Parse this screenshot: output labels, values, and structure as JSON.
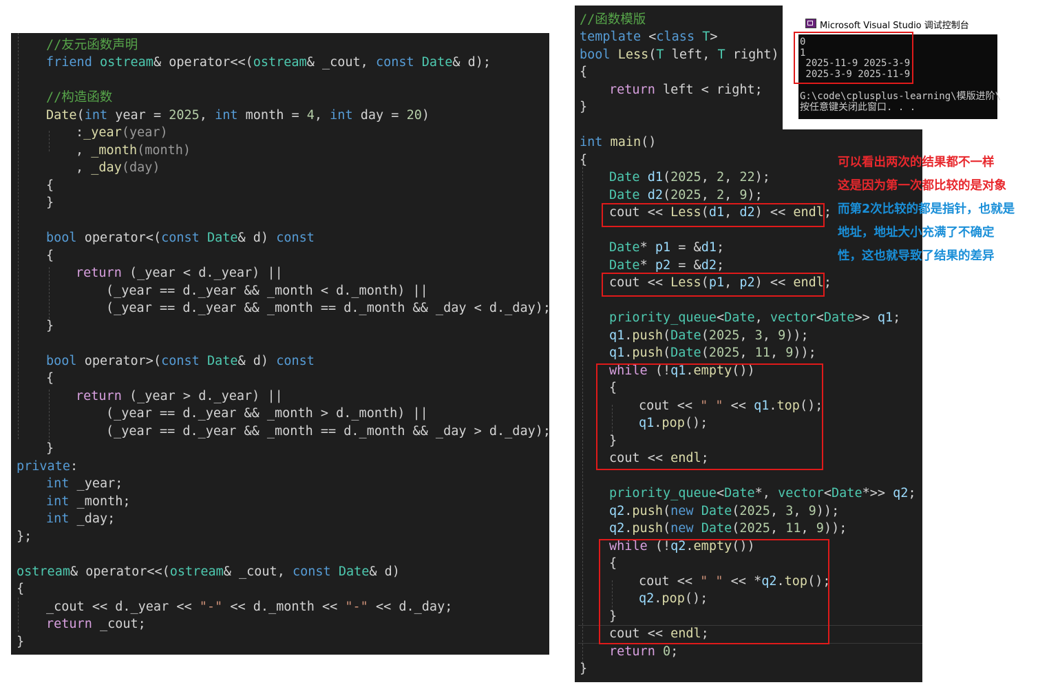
{
  "left_code": {
    "l01": "//友元函数声明",
    "l02_friend": "friend",
    "l02_ostream": "ostream",
    "l02_rest": "& operator<<(",
    "l02_ostream2": "ostream",
    "l02_rest2": "& _cout, ",
    "l02_const": "const",
    "l02_date": "Date",
    "l02_end": "& d);",
    "l03": "//构造函数",
    "l04_date": "Date",
    "l04_a": "(",
    "l04_int1": "int",
    "l04_b": " year = ",
    "l04_n1": "2025",
    "l04_c": ", ",
    "l04_int2": "int",
    "l04_d": " month = ",
    "l04_n2": "4",
    "l04_e": ", ",
    "l04_int3": "int",
    "l04_f": " day = ",
    "l04_n3": "20",
    "l04_g": ")",
    "l05_a": ":",
    "l05_b": "_year",
    "l05_c": "(year)",
    "l06_a": ", ",
    "l06_b": "_month",
    "l06_c": "(month)",
    "l07_a": ", ",
    "l07_b": "_day",
    "l07_c": "(day)",
    "l08": "{",
    "l09": "}",
    "l10_bool": "bool",
    "l10_a": " operator<(",
    "l10_const": "const",
    "l10_date": "Date",
    "l10_b": "& d) ",
    "l10_const2": "const",
    "l11": "{",
    "l12_ret": "return",
    "l12_rest": " (_year < d._year) ||",
    "l13": "(_year == d._year && _month < d._month) ||",
    "l14": "(_year == d._year && _month == d._month && _day < d._day);",
    "l15": "}",
    "l16_bool": "bool",
    "l16_a": " operator>(",
    "l16_const": "const",
    "l16_date": "Date",
    "l16_b": "& d) ",
    "l16_const2": "const",
    "l17": "{",
    "l18_ret": "return",
    "l18_rest": " (_year > d._year) ||",
    "l19": "(_year == d._year && _month > d._month) ||",
    "l20": "(_year == d._year && _month == d._month && _day > d._day);",
    "l21": "}",
    "l22_private": "private",
    "l22_colon": ":",
    "l23_int": "int",
    "l23_rest": " _year;",
    "l24_int": "int",
    "l24_rest": " _month;",
    "l25_int": "int",
    "l25_rest": " _day;",
    "l26": "};",
    "l27_ostream": "ostream",
    "l27_a": "& operator<<(",
    "l27_ostream2": "ostream",
    "l27_b": "& _cout, ",
    "l27_const": "const",
    "l27_date": "Date",
    "l27_c": "& d)",
    "l28": "{",
    "l29_a": "_cout << d._year << ",
    "l29_s1": "\"-\"",
    "l29_b": " << d._month << ",
    "l29_s2": "\"-\"",
    "l29_c": " << d._day;",
    "l30_ret": "return",
    "l30_rest": " _cout;",
    "l31": "}"
  },
  "right_code": {
    "r01": "//函数模版",
    "r02_template": "template",
    "r02_a": " <",
    "r02_class": "class",
    "r02_t": " T",
    "r02_b": ">",
    "r03_bool": "bool",
    "r03_less": " Less",
    "r03_a": "(",
    "r03_t1": "T",
    "r03_b": " left, ",
    "r03_t2": "T",
    "r03_c": " right)",
    "r04": "{",
    "r05_ret": "return",
    "r05_rest": " left < right;",
    "r06": "}",
    "r07_int": "int",
    "r07_main": " main",
    "r07_rest": "()",
    "r08": "{",
    "r09_date": "Date",
    "r09_d1": " d1",
    "r09_a": "(",
    "r09_n1": "2025",
    "r09_b": ", ",
    "r09_n2": "2",
    "r09_c": ", ",
    "r09_n3": "22",
    "r09_d": ");",
    "r10_date": "Date",
    "r10_d2": " d2",
    "r10_a": "(",
    "r10_n1": "2025",
    "r10_b": ", ",
    "r10_n2": "2",
    "r10_c": ", ",
    "r10_n3": "9",
    "r10_d": ");",
    "r11_a": "cout << ",
    "r11_less": "Less",
    "r11_b": "(",
    "r11_d1": "d1",
    "r11_c": ", ",
    "r11_d2": "d2",
    "r11_d": ") << ",
    "r11_endl": "endl",
    "r11_e": ";",
    "r12_date": "Date",
    "r12_a": "* ",
    "r12_p1": "p1",
    "r12_b": " = &",
    "r12_d1": "d1",
    "r12_c": ";",
    "r13_date": "Date",
    "r13_a": "* ",
    "r13_p2": "p2",
    "r13_b": " = &",
    "r13_d2": "d2",
    "r13_c": ";",
    "r14_a": "cout << ",
    "r14_less": "Less",
    "r14_b": "(",
    "r14_p1": "p1",
    "r14_c": ", ",
    "r14_p2": "p2",
    "r14_d": ") << ",
    "r14_endl": "endl",
    "r14_e": ";",
    "r15_pq": "priority_queue",
    "r15_a": "<",
    "r15_date": "Date",
    "r15_b": ", ",
    "r15_vec": "vector",
    "r15_c": "<",
    "r15_date2": "Date",
    "r15_d": ">> ",
    "r15_q1": "q1",
    "r15_e": ";",
    "r16_q1": "q1",
    "r16_a": ".",
    "r16_push": "push",
    "r16_b": "(",
    "r16_date": "Date",
    "r16_c": "(",
    "r16_n1": "2025",
    "r16_d": ", ",
    "r16_n2": "3",
    "r16_e": ", ",
    "r16_n3": "9",
    "r16_f": "));",
    "r17_q1": "q1",
    "r17_a": ".",
    "r17_push": "push",
    "r17_b": "(",
    "r17_date": "Date",
    "r17_c": "(",
    "r17_n1": "2025",
    "r17_d": ", ",
    "r17_n2": "11",
    "r17_e": ", ",
    "r17_n3": "9",
    "r17_f": "));",
    "r18_while": "while",
    "r18_a": " (!",
    "r18_q1": "q1",
    "r18_b": ".",
    "r18_empty": "empty",
    "r18_c": "())",
    "r19": "{",
    "r20_a": "cout << ",
    "r20_s": "\" \"",
    "r20_b": " << ",
    "r20_q1": "q1",
    "r20_c": ".",
    "r20_top": "top",
    "r20_d": "();",
    "r21_q1": "q1",
    "r21_a": ".",
    "r21_pop": "pop",
    "r21_b": "();",
    "r22": "}",
    "r23_a": "cout << ",
    "r23_endl": "endl",
    "r23_b": ";",
    "r24_pq": "priority_queue",
    "r24_a": "<",
    "r24_date": "Date",
    "r24_b": "*, ",
    "r24_vec": "vector",
    "r24_c": "<",
    "r24_date2": "Date",
    "r24_d": "*>> ",
    "r24_q2": "q2",
    "r24_e": ";",
    "r25_q2": "q2",
    "r25_a": ".",
    "r25_push": "push",
    "r25_b": "(",
    "r25_new": "new",
    "r25_sp": " ",
    "r25_date": "Date",
    "r25_c": "(",
    "r25_n1": "2025",
    "r25_d": ", ",
    "r25_n2": "3",
    "r25_e": ", ",
    "r25_n3": "9",
    "r25_f": "));",
    "r26_q2": "q2",
    "r26_a": ".",
    "r26_push": "push",
    "r26_b": "(",
    "r26_new": "new",
    "r26_sp": " ",
    "r26_date": "Date",
    "r26_c": "(",
    "r26_n1": "2025",
    "r26_d": ", ",
    "r26_n2": "11",
    "r26_e": ", ",
    "r26_n3": "9",
    "r26_f": "));",
    "r27_while": "while",
    "r27_a": " (!",
    "r27_q2": "q2",
    "r27_b": ".",
    "r27_empty": "empty",
    "r27_c": "())",
    "r28": "{",
    "r29_a": "cout << ",
    "r29_s": "\" \"",
    "r29_b": " << *",
    "r29_q2": "q2",
    "r29_c": ".",
    "r29_top": "top",
    "r29_d": "();",
    "r30_q2": "q2",
    "r30_a": ".",
    "r30_pop": "pop",
    "r30_b": "();",
    "r31": "}",
    "r32_a": "cout << ",
    "r32_endl": "endl",
    "r32_b": ";",
    "r33_ret": "return",
    "r33_sp": " ",
    "r33_n": "0",
    "r33_b": ";",
    "r34": "}"
  },
  "console": {
    "title": "Microsoft Visual Studio 调试控制台",
    "lines": [
      "0",
      "1",
      " 2025-11-9 2025-3-9",
      " 2025-3-9 2025-11-9",
      "",
      "G:\\code\\cplusplus-learning\\模版进阶\\",
      "按任意键关闭此窗口. . ."
    ]
  },
  "notes": [
    "可以看出两次的结果都不一样",
    "这是因为第一次都比较的是对象",
    "而第2次比较的都是指针，也就是",
    "地址，地址大小充满了不确定",
    "性，这也就导致了结果的差异"
  ],
  "colors": {
    "editor_bg": "#1e1e1e",
    "keyword": "#569cd6",
    "type": "#4ec9b0",
    "function": "#dcdcaa",
    "number": "#b5cea8",
    "string": "#ce9178",
    "comment": "#57a64a",
    "variable": "#9cdcfe",
    "control": "#d8a0df",
    "highlight_box": "#e01a1a",
    "note_red": "#e8282d",
    "note_blue": "#1a8fd8"
  }
}
